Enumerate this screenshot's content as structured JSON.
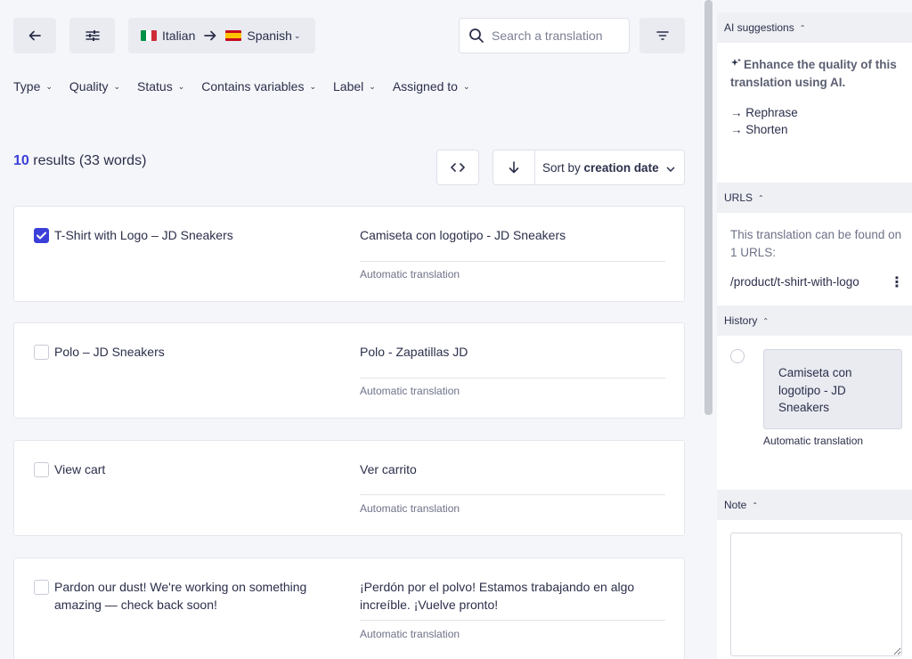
{
  "toolbar": {
    "source_language": "Italian",
    "target_language": "Spanish",
    "search_placeholder": "Search a translation"
  },
  "colors": {
    "accent": "#3b3fd8",
    "italy_flag": [
      "#009246",
      "#ffffff",
      "#ce2b37"
    ],
    "spain_flag": [
      "#c60b1e",
      "#ffc400",
      "#c60b1e"
    ]
  },
  "filters": [
    "Type",
    "Quality",
    "Status",
    "Contains variables",
    "Label",
    "Assigned to"
  ],
  "results": {
    "count": "10",
    "suffix": " results (33 words)"
  },
  "sort": {
    "prefix": "Sort by",
    "field": "creation date"
  },
  "rows": [
    {
      "source": "T-Shirt with Logo – JD Sneakers",
      "target": "Camiseta con logotipo - JD Sneakers",
      "meta": "Automatic translation",
      "checked": true
    },
    {
      "source": "Polo – JD Sneakers",
      "target": "Polo - Zapatillas JD",
      "meta": "Automatic translation",
      "checked": false
    },
    {
      "source": "View cart",
      "target": "Ver carrito",
      "meta": "Automatic translation",
      "checked": false
    },
    {
      "source": "Pardon our dust! We're working on something amazing — check back soon!",
      "target": "¡Perdón por el polvo! Estamos trabajando en algo increíble. ¡Vuelve pronto!",
      "meta": "Automatic translation",
      "checked": false
    }
  ],
  "sidebar": {
    "ai": {
      "title": "AI suggestions",
      "description": "Enhance the quality of this translation using AI.",
      "rephrase": "→ Rephrase",
      "shorten": "→ Shorten"
    },
    "urls": {
      "title": "URLS",
      "description": "This translation can be found on 1 URLS:",
      "path": "/product/t-shirt-with-logo"
    },
    "history": {
      "title": "History",
      "entry": "Camiseta con logotipo - JD Sneakers",
      "meta": "Automatic translation"
    },
    "note": {
      "title": "Note"
    }
  }
}
